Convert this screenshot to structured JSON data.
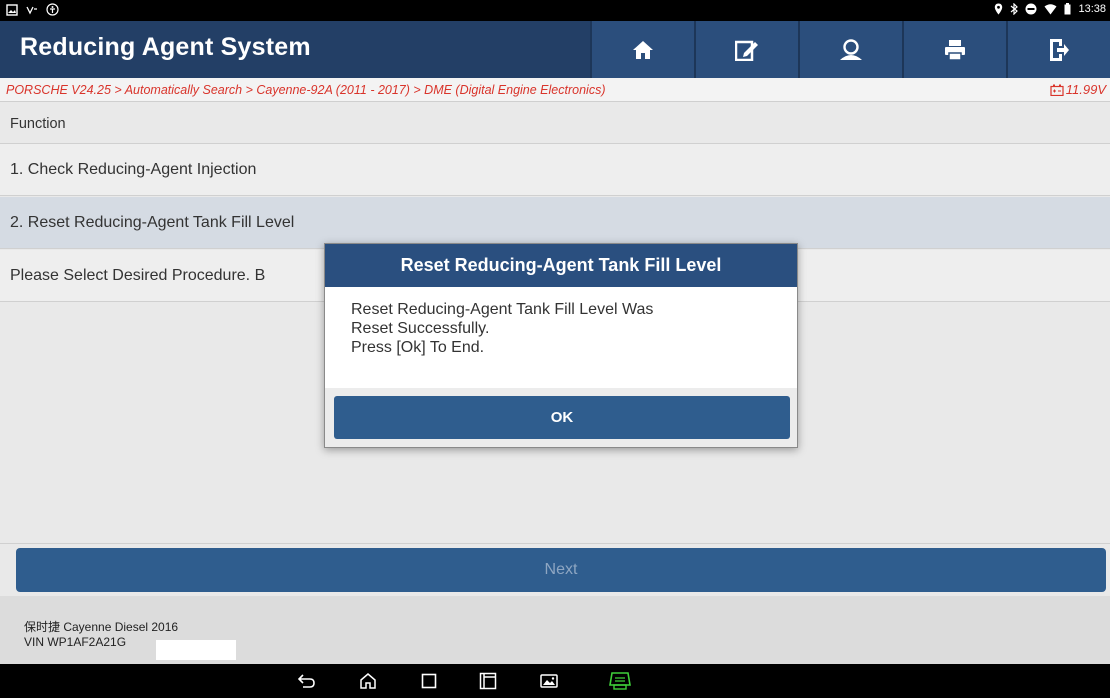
{
  "status_bar": {
    "time": "13:38",
    "icons_left": [
      "image-notification-icon",
      "signal-app-icon",
      "accessibility-icon"
    ],
    "icons_right": [
      "location-icon",
      "bluetooth-icon",
      "dnd-icon",
      "wifi-icon",
      "battery-icon"
    ]
  },
  "header": {
    "title": "Reducing Agent System",
    "buttons": [
      "home-icon",
      "edit-report-icon",
      "user-icon",
      "print-icon",
      "exit-icon"
    ]
  },
  "breadcrumb": {
    "path": "PORSCHE V24.25 > Automatically Search > Cayenne-92A (2011 - 2017) > DME (Digital Engine Electronics)",
    "battery_voltage": "11.99V"
  },
  "list": {
    "header": "Function",
    "items": [
      "1. Check Reducing-Agent Injection",
      "2. Reset Reducing-Agent Tank Fill Level",
      "Please Select Desired Procedure.  B"
    ]
  },
  "next_label": "Next",
  "vehicle": {
    "name": "保时捷 Cayenne Diesel 2016",
    "vin": "VIN WP1AF2A21G"
  },
  "dialog": {
    "title": "Reset Reducing-Agent Tank Fill Level",
    "message_lines": [
      "Reset Reducing-Agent Tank Fill Level Was",
      "Reset Successfully.",
      "Press [Ok] To End."
    ],
    "ok_label": "OK"
  },
  "colors": {
    "header_bg": "#233f66",
    "button_blue": "#2f5d8e",
    "breadcrumb_text": "#d9342b",
    "vci_green": "#3fcf3a"
  }
}
